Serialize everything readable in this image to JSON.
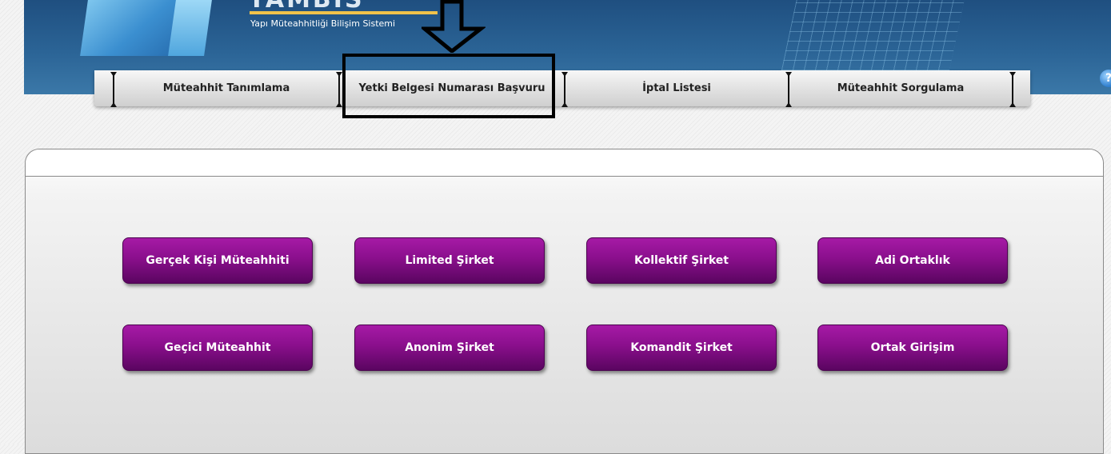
{
  "header": {
    "logo_text": "YAMBİS",
    "subtitle": "Yapı Müteahhitliği Bilişim Sistemi",
    "help_label": "?"
  },
  "menu": {
    "items": [
      {
        "label": "Müteahhit Tanımlama"
      },
      {
        "label": "Yetki Belgesi Numarası Başvuru"
      },
      {
        "label": "İptal Listesi"
      },
      {
        "label": "Müteahhit Sorgulama"
      }
    ]
  },
  "buttons": [
    {
      "label": "Gerçek Kişi Müteahhiti"
    },
    {
      "label": "Limited Şirket"
    },
    {
      "label": "Kollektif Şirket"
    },
    {
      "label": "Adi Ortaklık"
    },
    {
      "label": "Geçici Müteahhit"
    },
    {
      "label": "Anonim Şirket"
    },
    {
      "label": "Komandit Şirket"
    },
    {
      "label": "Ortak Girişim"
    }
  ],
  "colors": {
    "button_purple": "#8a0f8c",
    "header_blue": "#2b6496",
    "highlight": "#000000"
  }
}
